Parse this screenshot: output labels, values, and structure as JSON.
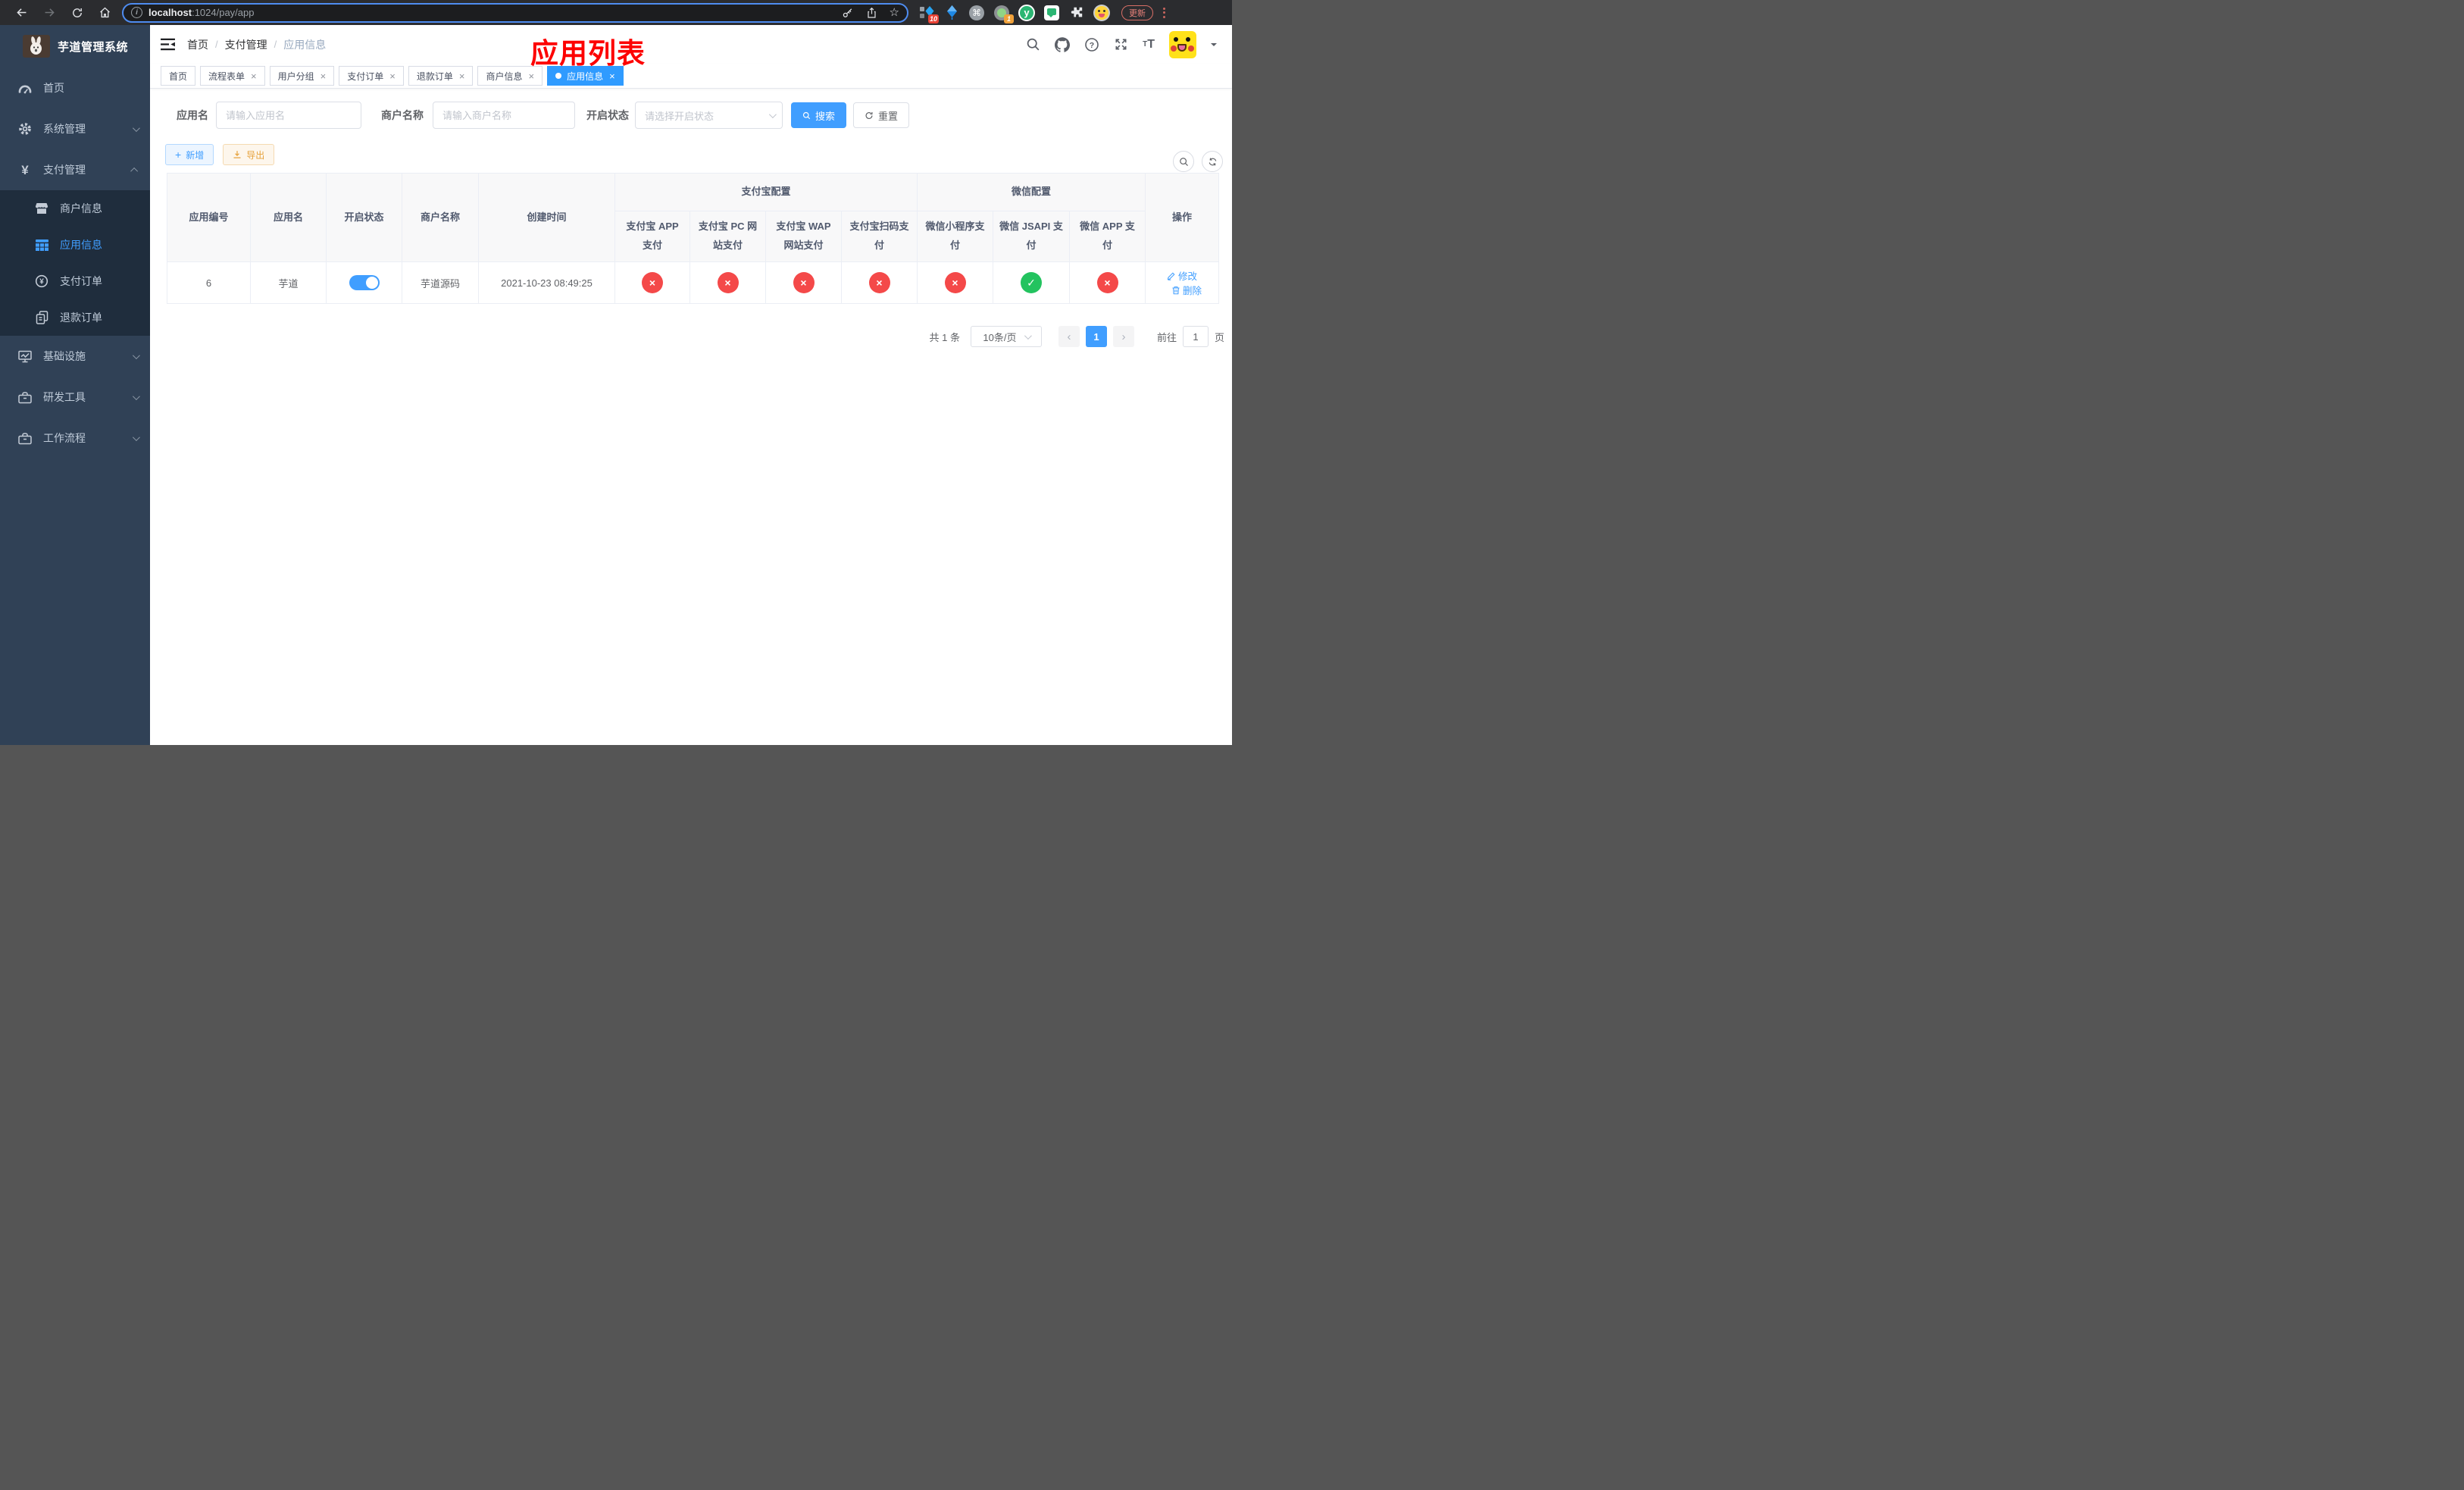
{
  "browser": {
    "url_host": "localhost",
    "url_path": ":1024/pay/app",
    "update_label": "更新",
    "ext_badge_pin": "10",
    "ext_badge_rec": "1",
    "ext_y_label": "y"
  },
  "sidebar": {
    "title": "芋道管理系统",
    "items": [
      {
        "label": "首页"
      },
      {
        "label": "系统管理"
      },
      {
        "label": "支付管理"
      },
      {
        "label": "商户信息"
      },
      {
        "label": "应用信息"
      },
      {
        "label": "支付订单"
      },
      {
        "label": "退款订单"
      },
      {
        "label": "基础设施"
      },
      {
        "label": "研发工具"
      },
      {
        "label": "工作流程"
      }
    ]
  },
  "header": {
    "breadcrumb": [
      "首页",
      "支付管理",
      "应用信息"
    ],
    "overlay_title": "应用列表"
  },
  "tabs": {
    "items": [
      "首页",
      "流程表单",
      "用户分组",
      "支付订单",
      "退款订单",
      "商户信息",
      "应用信息"
    ]
  },
  "search": {
    "app_name_label": "应用名",
    "app_name_placeholder": "请输入应用名",
    "merchant_label": "商户名称",
    "merchant_placeholder": "请输入商户名称",
    "status_label": "开启状态",
    "status_placeholder": "请选择开启状态",
    "search_label": "搜索",
    "reset_label": "重置"
  },
  "toolbar": {
    "add_label": "新增",
    "export_label": "导出"
  },
  "table": {
    "headers": {
      "app_id": "应用编号",
      "app_name": "应用名",
      "status": "开启状态",
      "merchant": "商户名称",
      "created": "创建时间",
      "alipay_group": "支付宝配置",
      "wechat_group": "微信配置",
      "alipay_app": "支付宝 APP 支付",
      "alipay_pc": "支付宝 PC 网站支付",
      "alipay_wap": "支付宝 WAP 网站支付",
      "alipay_qr": "支付宝扫码支付",
      "wx_mini": "微信小程序支付",
      "wx_jsapi": "微信 JSAPI 支付",
      "wx_app": "微信 APP 支付",
      "actions": "操作"
    },
    "row": {
      "app_id": "6",
      "app_name": "芋道",
      "enabled": true,
      "merchant": "芋道源码",
      "created": "2021-10-23 08:49:25",
      "statuses": [
        "fail",
        "fail",
        "fail",
        "fail",
        "fail",
        "success",
        "fail"
      ],
      "edit_label": "修改",
      "delete_label": "删除"
    }
  },
  "pagination": {
    "total": "共 1 条",
    "page_size": "10条/页",
    "page": "1",
    "goto_label": "前往",
    "goto_value": "1",
    "page_suffix": "页"
  },
  "icons": {
    "close": "×",
    "prev": "‹",
    "next": "›",
    "plus": "+",
    "star": "☆",
    "cmd": "⌘",
    "info": "i",
    "question": "?",
    "yen": "¥",
    "check": "✓",
    "cross": "×",
    "sep": "/",
    "font_small": "T",
    "font_large": "T"
  },
  "colors": {
    "accent": "#409eff",
    "success": "#23c35f",
    "danger": "#f44949",
    "warning": "#e6a23c",
    "sidebar_bg": "#304156",
    "submenu_bg": "#1f2d3d"
  }
}
